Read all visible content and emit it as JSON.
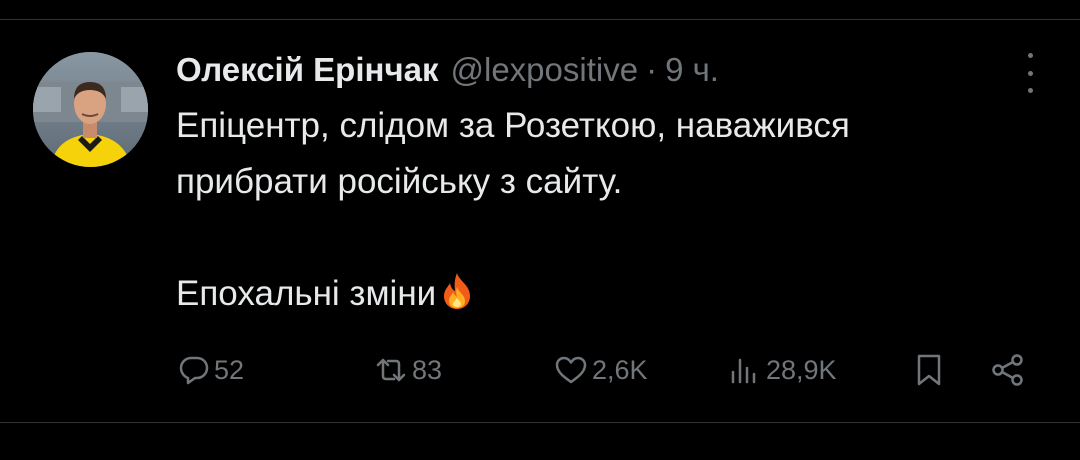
{
  "tweet": {
    "author_name": "Олексій Ерінчак",
    "author_handle": "@lexpositive",
    "separator": "·",
    "time": "9 ч.",
    "avatar_icon": "user-avatar",
    "more_icon": "more-vertical-icon",
    "text_lines": [
      "Епіцентр, слідом за Розеткою, наважився",
      "прибрати російську з сайту.",
      "",
      "Епохальні зміни"
    ],
    "emoji": "fire-emoji"
  },
  "actions": {
    "reply": {
      "icon": "reply-icon",
      "count": "52"
    },
    "retweet": {
      "icon": "retweet-icon",
      "count": "83"
    },
    "like": {
      "icon": "heart-icon",
      "count": "2,6K"
    },
    "views": {
      "icon": "views-icon",
      "count": "28,9K"
    },
    "bookmark": {
      "icon": "bookmark-icon"
    },
    "share": {
      "icon": "share-icon"
    }
  },
  "colors": {
    "background": "#000000",
    "text_primary": "#e7e9ea",
    "text_secondary": "#71767b",
    "divider": "#2f3336",
    "avatar_jacket": "#f5d20a"
  }
}
